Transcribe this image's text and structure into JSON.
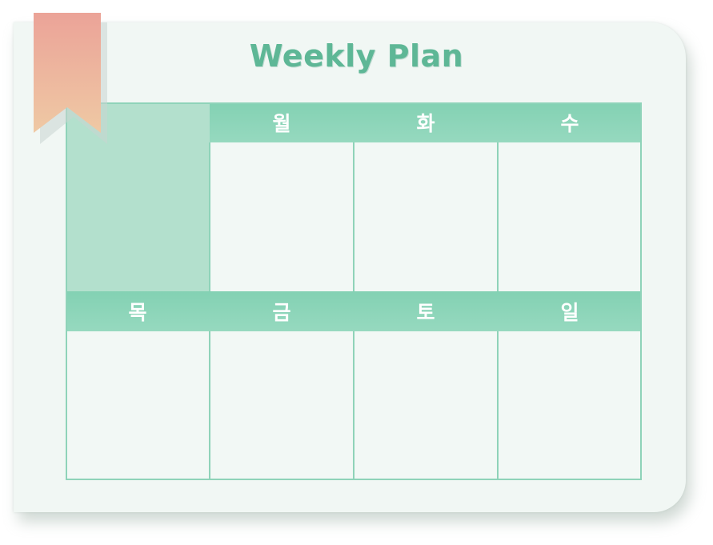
{
  "title": "Weekly Plan",
  "days_top": [
    "월",
    "화",
    "수"
  ],
  "days_bottom": [
    "목",
    "금",
    "토",
    "일"
  ],
  "colors": {
    "title": "#5eb796",
    "header": "#8fd5ba",
    "grid_line": "#8fd3b9",
    "corner_block": "#b3e0cd",
    "ribbon_top": "#eba398",
    "ribbon_bottom": "#efc9a4"
  },
  "icons": {
    "ribbon": "bookmark-ribbon-icon"
  }
}
